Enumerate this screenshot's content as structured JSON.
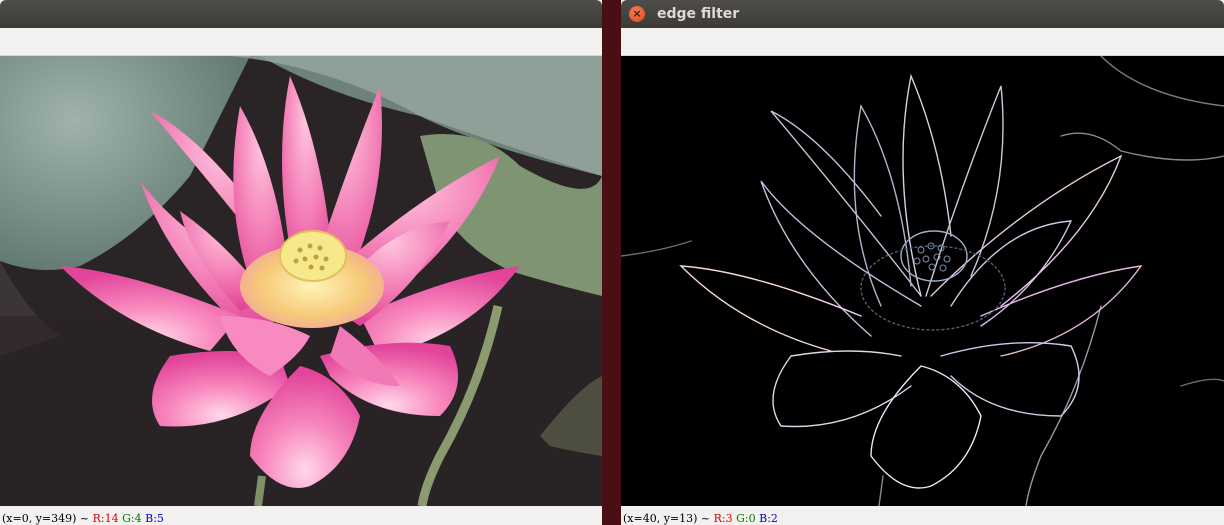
{
  "windows": [
    {
      "title": "",
      "status": {
        "coords": "(x=0, y=349) ~ ",
        "r": "R:14",
        "g": "G:4",
        "b": "B:5"
      },
      "image": "pink lotus flower on dark background with lotus leaves"
    },
    {
      "title": "edge filter",
      "close_icon": "×",
      "status": {
        "coords": "(x=40, y=13) ~ ",
        "r": "R:3",
        "g": "G:0",
        "b": "B:2"
      },
      "image": "edge-detected lotus outline on black"
    }
  ],
  "colors": {
    "desktop": "#4a0f14",
    "titlebar": "#3c3b37",
    "close_button": "#df4a16",
    "window_bg": "#f2f1f0",
    "lotus_pink": "#f06aa8",
    "edge_bg": "#000000"
  },
  "icons": {
    "close": "close-icon"
  }
}
